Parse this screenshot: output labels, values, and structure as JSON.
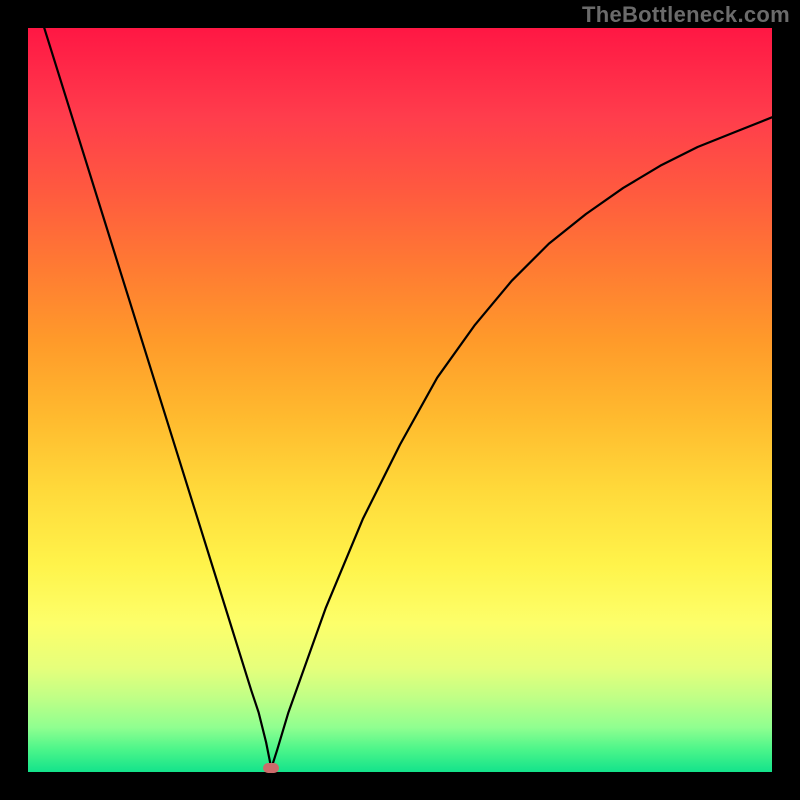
{
  "watermark": "TheBottleneck.com",
  "colors": {
    "curve_stroke": "#000000",
    "marker_fill": "#cc6b6b",
    "background": "#000000"
  },
  "chart_data": {
    "type": "line",
    "title": "",
    "xlabel": "",
    "ylabel": "",
    "xlim": [
      0,
      100
    ],
    "ylim": [
      0,
      100
    ],
    "grid": false,
    "legend": false,
    "series": [
      {
        "name": "bottleneck-curve",
        "x": [
          0,
          2.5,
          5,
          7.5,
          10,
          12.5,
          15,
          17.5,
          20,
          22.5,
          25,
          27.5,
          30,
          31,
          32,
          32.7,
          33.5,
          35,
          37.5,
          40,
          42.5,
          45,
          47.5,
          50,
          55,
          60,
          65,
          70,
          75,
          80,
          85,
          90,
          95,
          100
        ],
        "y": [
          107,
          99,
          91,
          83,
          75,
          67,
          59,
          51,
          43,
          35,
          27,
          19,
          11,
          8,
          4,
          0.5,
          3,
          8,
          15,
          22,
          28,
          34,
          39,
          44,
          53,
          60,
          66,
          71,
          75,
          78.5,
          81.5,
          84,
          86,
          88
        ]
      }
    ],
    "annotations": [
      {
        "name": "min-marker",
        "x": 32.7,
        "y": 0.5
      }
    ],
    "gradient_stops": [
      {
        "pos": 0,
        "color": "#ff1744"
      },
      {
        "pos": 50,
        "color": "#ffb92e"
      },
      {
        "pos": 80,
        "color": "#fdff6a"
      },
      {
        "pos": 100,
        "color": "#13e38b"
      }
    ]
  }
}
